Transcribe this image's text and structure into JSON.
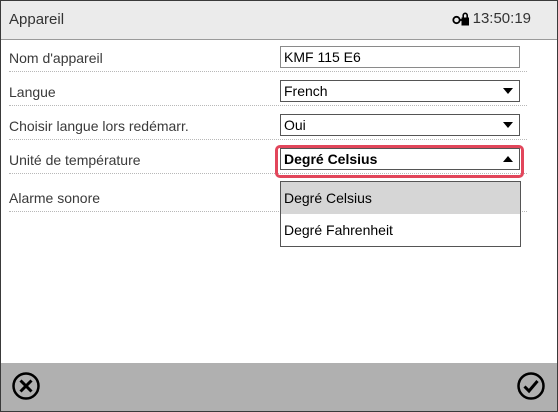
{
  "header": {
    "title": "Appareil",
    "time": "13:50:19",
    "lock_icon": "key-lock-icon"
  },
  "rows": [
    {
      "label": "Nom d'appareil",
      "value": "KMF 115 E6",
      "kind": "text-input"
    },
    {
      "label": "Langue",
      "value": "French",
      "kind": "select"
    },
    {
      "label": "Choisir langue lors redémarr.",
      "value": "Oui",
      "kind": "select"
    },
    {
      "label": "Unité de température",
      "value": "Degré Celsius",
      "kind": "select-open"
    },
    {
      "label": "Alarme sonore",
      "value": "",
      "kind": "hidden-by-dropdown"
    }
  ],
  "dropdown": {
    "options": [
      "Degré Celsius",
      "Degré Fahrenheit"
    ],
    "selected_index": 0
  },
  "footer": {
    "cancel_icon": "cancel-circle-x-icon",
    "confirm_icon": "confirm-circle-check-icon"
  },
  "colors": {
    "focus_ring": "#e2465b",
    "footer_bg": "#b0b0b0",
    "header_bg": "#ebebeb"
  }
}
